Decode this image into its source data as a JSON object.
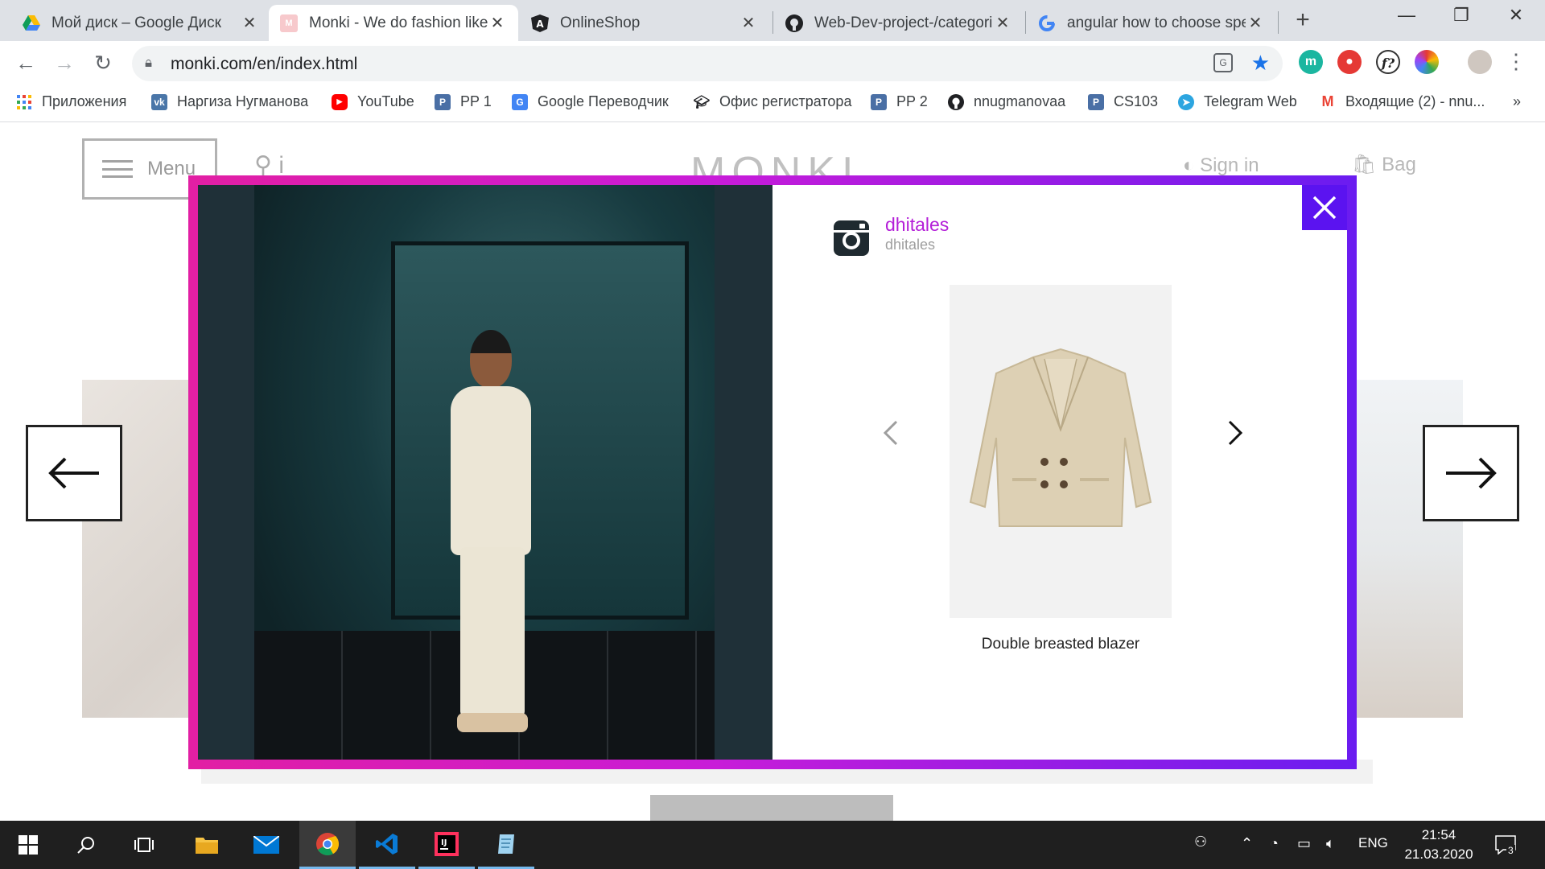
{
  "browser": {
    "tabs": [
      {
        "title": "Мой диск – Google Диск",
        "icon": "google-drive-icon"
      },
      {
        "title": "Monki - We do fashion like",
        "icon": "monki-icon",
        "active": true
      },
      {
        "title": "OnlineShop",
        "icon": "angular-icon"
      },
      {
        "title": "Web-Dev-project-/categori",
        "icon": "github-icon"
      },
      {
        "title": "angular how to choose spe",
        "icon": "google-icon"
      }
    ],
    "url": "monki.com/en/index.html",
    "bookmarks": [
      {
        "label": "Приложения",
        "icon": "apps-grid-icon"
      },
      {
        "label": "Наргиза Нугманова",
        "icon": "vk-icon"
      },
      {
        "label": "YouTube",
        "icon": "youtube-icon"
      },
      {
        "label": "PP 1",
        "icon": "p-icon"
      },
      {
        "label": "Google Переводчик",
        "icon": "google-translate-icon"
      },
      {
        "label": "Офис регистратора",
        "icon": "graduation-cap-icon"
      },
      {
        "label": "PP 2",
        "icon": "p-icon"
      },
      {
        "label": "nnugmanovaa",
        "icon": "github-icon"
      },
      {
        "label": "CS103",
        "icon": "p-icon"
      },
      {
        "label": "Telegram Web",
        "icon": "telegram-icon"
      },
      {
        "label": "Входящие (2) - nnu...",
        "icon": "gmail-icon"
      }
    ],
    "more_bookmarks": "»"
  },
  "site": {
    "menu_label": "Menu",
    "search_label": "i",
    "logo": "MONKI",
    "signin_label": "Sign in",
    "bag_label": "Bag"
  },
  "modal": {
    "username": "dhitales",
    "subtitle": "dhitales",
    "product_name": "Double breasted blazer",
    "close_icon": "close-icon",
    "colors": {
      "frame_start": "#e21fa3",
      "frame_end": "#6a1cf0",
      "close_bg": "#5b13f0",
      "username": "#b41fd8"
    }
  },
  "taskbar": {
    "language": "ENG",
    "time": "21:54",
    "date": "21.03.2020",
    "notifications": "3"
  }
}
